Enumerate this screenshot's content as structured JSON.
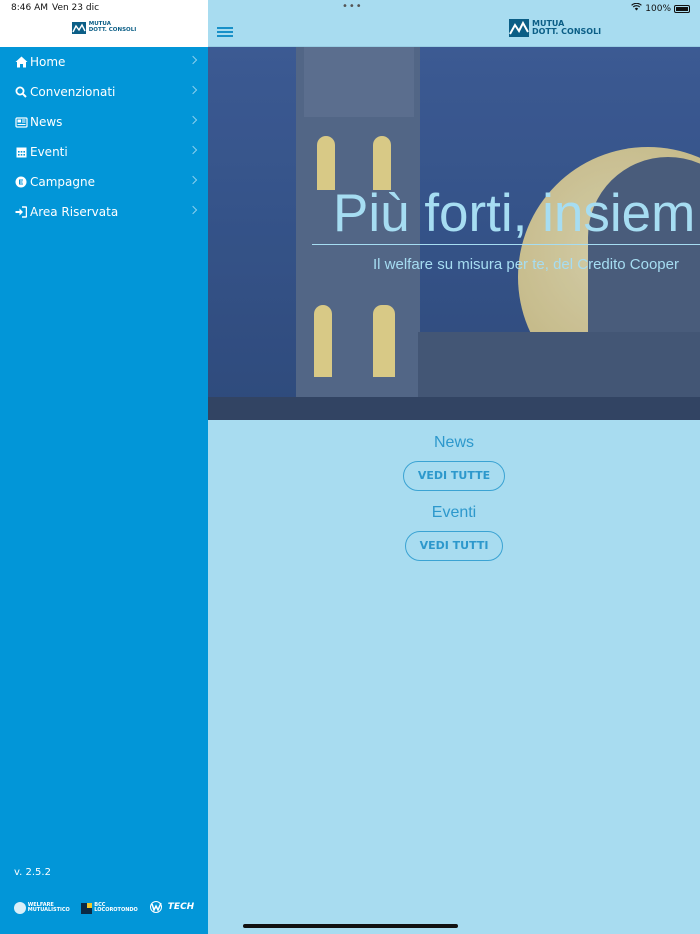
{
  "status_bar": {
    "time": "8:46 AM",
    "date": "Ven 23 dic",
    "dots": "•••",
    "battery": "100%"
  },
  "brand": {
    "line1": "MUTUA",
    "line2": "DOTT. CONSOLI",
    "color": "#0b5e86"
  },
  "sidebar": {
    "background": "#0296d8",
    "items": [
      {
        "label": "Home",
        "icon": "home-icon"
      },
      {
        "label": "Convenzionati",
        "icon": "search-icon"
      },
      {
        "label": "News",
        "icon": "newspaper-icon"
      },
      {
        "label": "Eventi",
        "icon": "calendar-icon"
      },
      {
        "label": "Campagne",
        "icon": "campaign-icon"
      },
      {
        "label": "Area Riservata",
        "icon": "sign-in-icon"
      }
    ],
    "version": "v. 2.5.2",
    "partners": [
      {
        "name": "WELFARE MUTUALISTICO",
        "icon": "welfare-logo-icon"
      },
      {
        "name": "BCC LOCOROTONDO",
        "icon": "bcc-logo-icon"
      },
      {
        "name": "TECH",
        "icon": "wtech-logo-icon"
      }
    ]
  },
  "hero": {
    "title": "Più forti, insiem",
    "subtitle": "Il welfare su misura per te, del Credito Cooper"
  },
  "sections": [
    {
      "title": "News",
      "button": "VEDI TUTTE"
    },
    {
      "title": "Eventi",
      "button": "VEDI TUTTI"
    }
  ],
  "colors": {
    "main_background": "#a8dcf0",
    "accent": "#2d98cc"
  }
}
